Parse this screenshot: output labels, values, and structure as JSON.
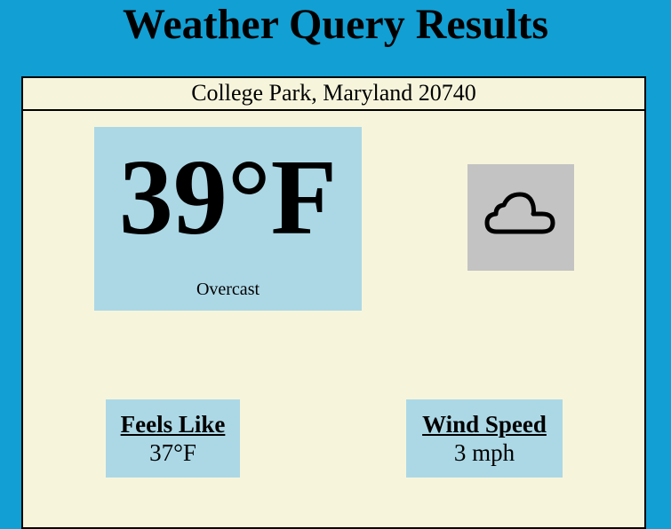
{
  "page": {
    "title": "Weather Query Results"
  },
  "location": {
    "label": "College Park, Maryland 20740"
  },
  "current": {
    "temperature": "39°F",
    "condition": "Overcast",
    "icon": "cloud-icon"
  },
  "stats": {
    "feels_like_label": "Feels Like",
    "feels_like_value": "37°F",
    "wind_speed_label": "Wind Speed",
    "wind_speed_value": "3 mph"
  },
  "colors": {
    "background": "#129fd3",
    "panel": "#f6f5dc",
    "highlight_box": "#acd8e6",
    "icon_box": "#c3c3c3"
  }
}
